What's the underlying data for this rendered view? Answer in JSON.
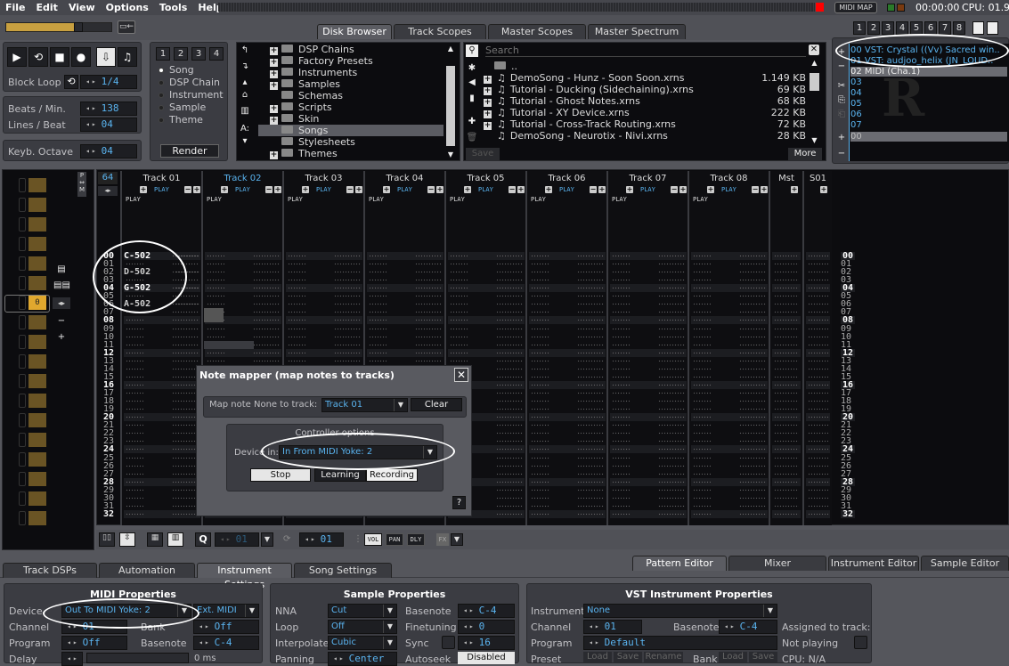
{
  "menu": [
    "File",
    "Edit",
    "View",
    "Options",
    "Tools",
    "Help"
  ],
  "status": {
    "midi_map": "MIDI MAP",
    "time": "00:00:00",
    "cpu": "CPU: 01.9",
    "led_colors": [
      "#2a7a2a",
      "#7a3a10"
    ],
    "master_volume_fraction": 0.65
  },
  "top_tabs": [
    "Disk Browser",
    "Track Scopes",
    "Master Scopes",
    "Master Spectrum"
  ],
  "top_tabs_active": 0,
  "view_presets": [
    "1",
    "2",
    "3",
    "4",
    "5",
    "6",
    "7",
    "8"
  ],
  "transport": {
    "block_loop_label": "Block Loop",
    "block_loop_value": "1/4",
    "bpm_label": "Beats / Min.",
    "bpm": "138",
    "lpb_label": "Lines / Beat",
    "lpb": "04",
    "octave_label": "Keyb. Octave",
    "octave": "04"
  },
  "render_panel": {
    "tabs": [
      "1",
      "2",
      "3",
      "4"
    ],
    "options": [
      "Song",
      "DSP Chain",
      "Instrument",
      "Sample",
      "Theme"
    ],
    "selected": "Song",
    "render_label": "Render"
  },
  "folder_tree": [
    {
      "name": "DSP Chains",
      "expandable": true
    },
    {
      "name": "Factory Presets",
      "expandable": true
    },
    {
      "name": "Instruments",
      "expandable": true
    },
    {
      "name": "Samples",
      "expandable": true
    },
    {
      "name": "Schemas",
      "expandable": false
    },
    {
      "name": "Scripts",
      "expandable": true
    },
    {
      "name": "Skin",
      "expandable": true
    },
    {
      "name": "Songs",
      "expandable": false,
      "selected": true
    },
    {
      "name": "Stylesheets",
      "expandable": false
    },
    {
      "name": "Themes",
      "expandable": true
    }
  ],
  "file_browser": {
    "search_placeholder": "Search",
    "parent": "..",
    "files": [
      {
        "name": "DemoSong - Hunz - Soon Soon.xrns",
        "size": "1.149 KB",
        "expandable": true
      },
      {
        "name": "Tutorial - Ducking (Sidechaining).xrns",
        "size": "69 KB",
        "expandable": true
      },
      {
        "name": "Tutorial - Ghost Notes.xrns",
        "size": "68 KB",
        "expandable": true
      },
      {
        "name": "Tutorial - XY Device.xrns",
        "size": "222 KB",
        "expandable": true
      },
      {
        "name": "Tutorial - Cross-Track Routing.xrns",
        "size": "72 KB",
        "expandable": true
      },
      {
        "name": "DemoSong - Neurotix - Nivi.xrns",
        "size": "28 KB",
        "expandable": false
      }
    ],
    "save_label": "Save",
    "more_label": "More"
  },
  "instruments": [
    {
      "index": "00",
      "name": "VST: Crystal ((Vv) Sacred win.."
    },
    {
      "index": "01",
      "name": "VST: audjoo_helix (JN_LOUD.."
    },
    {
      "index": "02",
      "name": "MIDI (Cha.1)",
      "selected": true
    },
    {
      "index": "03",
      "name": ""
    },
    {
      "index": "04",
      "name": ""
    },
    {
      "index": "05",
      "name": ""
    },
    {
      "index": "06",
      "name": ""
    },
    {
      "index": "07",
      "name": ""
    }
  ],
  "sample_list": [
    {
      "index": "00",
      "name": ""
    }
  ],
  "pattern": {
    "length": "64",
    "current_sequence": "0",
    "tracks": [
      "Track 01",
      "Track 02",
      "Track 03",
      "Track 04",
      "Track 05",
      "Track 06",
      "Track 07",
      "Track 08"
    ],
    "selected_track": "Track 02",
    "master": "Mst",
    "send": "S01",
    "play_label": "PLAY",
    "rows": [
      "00",
      "01",
      "02",
      "03",
      "04",
      "05",
      "06",
      "07",
      "08",
      "09",
      "10",
      "11",
      "12",
      "13",
      "14",
      "15",
      "16",
      "17",
      "18",
      "19",
      "20",
      "21",
      "22",
      "23",
      "24",
      "25",
      "26",
      "27",
      "28",
      "29",
      "30",
      "31",
      "32"
    ],
    "notes": [
      {
        "row": "00",
        "note": "C-502"
      },
      {
        "row": "02",
        "note": "D-502"
      },
      {
        "row": "04",
        "note": "G-502"
      },
      {
        "row": "06",
        "note": "A-502"
      }
    ]
  },
  "pattern_toolbar": {
    "instrument_value": "01",
    "step_value": "01",
    "columns": [
      "VOL",
      "PAN",
      "DLY",
      "FX"
    ]
  },
  "note_mapper": {
    "title": "Note mapper (map notes to tracks)",
    "map_note_label": "Map note  None to track:",
    "track": "Track 01",
    "clear_label": "Clear",
    "controller_title": "Controller options",
    "device_label": "Device in:",
    "device": "In From MIDI Yoke:  2",
    "stop_label": "Stop",
    "learning_label": "Learning",
    "recording_label": "Recording",
    "help_label": "?"
  },
  "lower_tabs_left": [
    "Track DSPs",
    "Automation",
    "Instrument Settings",
    "Song Settings"
  ],
  "lower_tabs_left_active": 2,
  "lower_tabs_right": [
    "Pattern Editor",
    "Mixer",
    "Instrument Editor",
    "Sample Editor"
  ],
  "lower_tabs_right_active": 0,
  "midi_props": {
    "title": "MIDI Properties",
    "device_label": "Device",
    "device": "Out To MIDI Yoke:  2",
    "ext": "Ext. MIDI",
    "channel_label": "Channel",
    "channel": "01",
    "bank_label": "Bank",
    "bank": "Off",
    "program_label": "Program",
    "program": "Off",
    "basenote_label": "Basenote",
    "basenote": "C-4",
    "delay_label": "Delay",
    "delay": "0 ms"
  },
  "sample_props": {
    "title": "Sample Properties",
    "nna_label": "NNA",
    "nna": "Cut",
    "loop_label": "Loop",
    "loop": "Off",
    "interp_label": "Interpolate",
    "interp": "Cubic",
    "panning_label": "Panning",
    "panning": "Center",
    "basenote_label": "Basenote",
    "basenote": "C-4",
    "finetune_label": "Finetuning",
    "finetune": "0",
    "sync_label": "Sync",
    "sync": "16",
    "autoseek_label": "Autoseek",
    "autoseek": "Disabled"
  },
  "vst_props": {
    "title": "VST Instrument Properties",
    "instrument_label": "Instrument",
    "instrument": "None",
    "channel_label": "Channel",
    "channel": "01",
    "basenote_label": "Basenote",
    "basenote": "C-4",
    "program_label": "Program",
    "program": "Default",
    "preset_label": "Preset",
    "bank_label": "Bank",
    "load_label": "Load",
    "save_label": "Save",
    "rename_label": "Rename",
    "assigned_label": "Assigned to track:",
    "not_playing_label": "Not playing",
    "cpu_label": "CPU: N/A"
  }
}
